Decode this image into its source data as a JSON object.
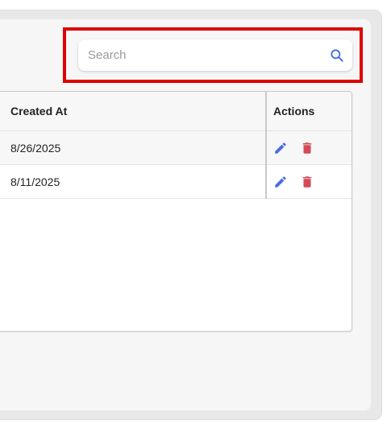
{
  "search": {
    "placeholder": "Search",
    "value": "",
    "icon": "search-icon"
  },
  "table": {
    "columns": [
      "Created At",
      "Actions"
    ],
    "rows": [
      {
        "created_at": "8/26/2025",
        "actions": [
          "edit-icon",
          "delete-icon"
        ]
      },
      {
        "created_at": "8/11/2025",
        "actions": [
          "edit-icon",
          "delete-icon"
        ]
      }
    ]
  },
  "colors": {
    "highlight": "#dd0000",
    "edit_icon": "#4a6ee0",
    "delete_icon": "#d24a55",
    "search_icon": "#3e6fdc"
  }
}
